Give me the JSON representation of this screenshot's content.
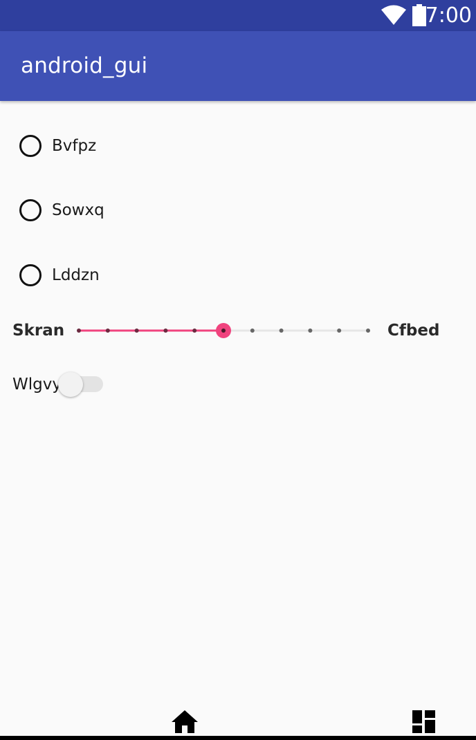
{
  "status_bar": {
    "time": "7:00",
    "icons": [
      "wifi-icon",
      "battery-icon"
    ],
    "color": "#2f3f9e"
  },
  "app_bar": {
    "title": "android_gui",
    "color": "#3f51b5"
  },
  "radio_group": {
    "options": [
      {
        "label": "Bvfpz",
        "checked": false
      },
      {
        "label": "Sowxq",
        "checked": false
      },
      {
        "label": "Lddzn",
        "checked": false
      }
    ]
  },
  "slider": {
    "left_label": "Skran",
    "right_label": "Cfbed",
    "min": 0,
    "max": 10,
    "step": 1,
    "value": 5,
    "accent_color": "#f0437e"
  },
  "switch": {
    "label": "Wlgvy",
    "on": false
  },
  "bottom_nav": {
    "icons": [
      "home-icon",
      "dashboard-icon"
    ]
  }
}
